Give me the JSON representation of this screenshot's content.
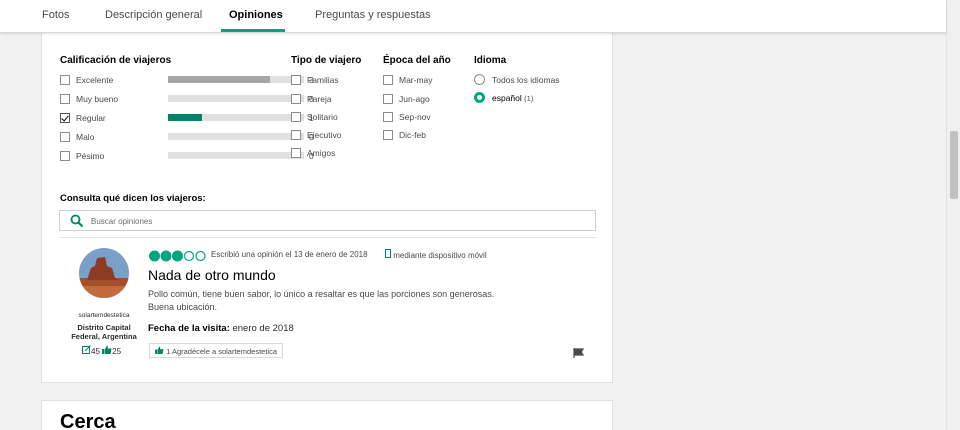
{
  "tabs": [
    {
      "label": "Fotos"
    },
    {
      "label": "Descripción general"
    },
    {
      "label": "Opiniones",
      "active": true
    },
    {
      "label": "Preguntas y respuestas"
    }
  ],
  "filters": {
    "rating": {
      "heading": "Calificación de viajeros",
      "items": [
        {
          "label": "Excelente",
          "count": "3",
          "fraction": 0.75,
          "checked": false
        },
        {
          "label": "Muy bueno",
          "count": "0",
          "fraction": 0,
          "checked": false
        },
        {
          "label": "Regular",
          "count": "1",
          "fraction": 0.25,
          "checked": true
        },
        {
          "label": "Malo",
          "count": "0",
          "fraction": 0,
          "checked": false
        },
        {
          "label": "Pésimo",
          "count": "0",
          "fraction": 0,
          "checked": false
        }
      ]
    },
    "traveler_type": {
      "heading": "Tipo de viajero",
      "items": [
        "Familias",
        "Pareja",
        "Solitario",
        "Ejecutivo",
        "Amigos"
      ]
    },
    "season": {
      "heading": "Época del año",
      "items": [
        "Mar-may",
        "Jun-ago",
        "Sep-nov",
        "Dic-feb"
      ]
    },
    "language": {
      "heading": "Idioma",
      "items": [
        {
          "label": "Todos los idiomas",
          "selected": false
        },
        {
          "label": "español",
          "count": "(1)",
          "selected": true
        }
      ]
    }
  },
  "search": {
    "heading": "Consulta qué dicen los viajeros:",
    "placeholder": "Buscar opiniones"
  },
  "review": {
    "user": {
      "name": "solartemdestetica",
      "location_line1": "Distrito Capital",
      "location_line2": "Federal, Argentina",
      "contributions": "45",
      "helpful_votes": "25"
    },
    "rating_bubbles": 3,
    "written": "Escribió una opinión el 13 de enero de 2018",
    "via": "mediante dispositivo móvil",
    "title": "Nada de otro mundo",
    "body_line1": "Pollo común, tiene buen sabor, lo único a resaltar es que las porciones son generosas.",
    "body_line2": "Buena ubicación.",
    "visit_label": "Fecha de la visita:",
    "visit_value": "enero de 2018",
    "thanks_count": "1",
    "thanks_label": "Agradécele a solartemdestetica"
  },
  "nearby": {
    "title": "Cerca"
  },
  "colors": {
    "accent": "#00a680",
    "bar_grey": "#a6a6a6"
  }
}
